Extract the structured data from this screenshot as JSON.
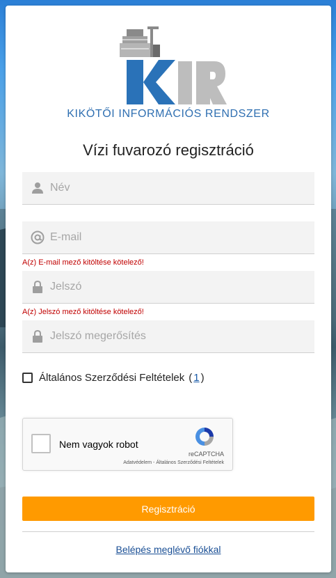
{
  "header": {
    "logo_text": "KIR",
    "subtitle": "KIKÖTŐI INFORMÁCIÓS RENDSZER"
  },
  "form": {
    "title": "Vízi fuvarozó regisztráció",
    "name_placeholder": "Név",
    "email_placeholder": "E-mail",
    "email_error": "A(z) E-mail mező kitöltése kötelező!",
    "password_placeholder": "Jelszó",
    "password_error": "A(z) Jelszó mező kitöltése kötelező!",
    "confirm_placeholder": "Jelszó megerősítés",
    "terms_label": "Általános Szerződési Feltételek",
    "terms_open": "(",
    "terms_link": "1",
    "terms_close": ")",
    "submit_label": "Regisztráció",
    "login_link": "Belépés meglévő fiókkal"
  },
  "recaptcha": {
    "label": "Nem vagyok robot",
    "brand": "reCAPTCHA",
    "links": "Adatvédelem - Általános Szerződési Feltételek"
  },
  "colors": {
    "accent": "#ff9a00",
    "brand_blue": "#2f6fb1",
    "error": "#c00000"
  }
}
